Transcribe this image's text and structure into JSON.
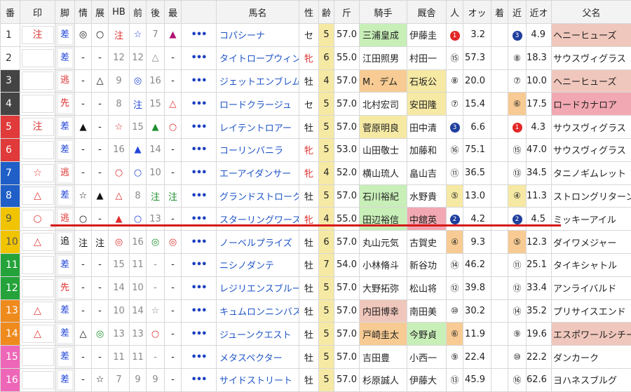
{
  "headers": [
    "番",
    "印",
    "脚",
    "情",
    "展",
    "HB",
    "前",
    "後",
    "最",
    "",
    "馬名",
    "性",
    "齢",
    "斤",
    "騎手",
    "厩舎",
    "人",
    "オッ",
    "着",
    "近",
    "近オ",
    "父名"
  ],
  "colors": {
    "num_bg": [
      "#ffffff",
      "#ffffff",
      "#444444",
      "#444444",
      "#e03a3a",
      "#e03a3a",
      "#1f5fc7",
      "#1f5fc7",
      "#f0c400",
      "#f0c400",
      "#25a33a",
      "#25a33a",
      "#ef8a1d",
      "#ef8a1d",
      "#ee66b8",
      "#ee66b8"
    ]
  },
  "rows": [
    {
      "num": "1",
      "mark": "注",
      "legs": "差",
      "j": "◎",
      "t": "○",
      "hb": "注",
      "f": "☆",
      "b": "7",
      "s": "▲",
      "more": "•••",
      "name": "コパシーナ",
      "sex": "セ",
      "age": "5",
      "kin": "57.0",
      "jockey": "三浦皇成",
      "trainer": "伊藤圭",
      "pop": "1",
      "odds": "3.2",
      "chaku": "",
      "kin_pop": "3",
      "kin_odds": "4.9",
      "sire": "ヘニーヒューズ"
    },
    {
      "num": "2",
      "mark": "",
      "legs": "差",
      "j": "-",
      "t": "-",
      "hb": "12",
      "f": "12",
      "b": "△",
      "s": "-",
      "more": "•••",
      "name": "タイトロープウィン",
      "sex": "牝",
      "age": "6",
      "kin": "55.0",
      "jockey": "江田照男",
      "trainer": "村田一",
      "pop": "⑮",
      "odds": "57.3",
      "chaku": "",
      "kin_pop": "⑧",
      "kin_odds": "18.3",
      "sire": "サウスヴィグラス"
    },
    {
      "num": "3",
      "mark": "",
      "legs": "逃",
      "j": "-",
      "t": "△",
      "hb": "9",
      "f": "◎",
      "b": "16",
      "s": "-",
      "more": "•••",
      "name": "ジェットエンブレム",
      "sex": "牡",
      "age": "4",
      "kin": "57.0",
      "jockey": "M．デム",
      "trainer": "石坂公",
      "pop": "⑧",
      "odds": "20.0",
      "chaku": "",
      "kin_pop": "⑦",
      "kin_odds": "10.0",
      "sire": "ヘニーヒューズ"
    },
    {
      "num": "4",
      "mark": "",
      "legs": "先",
      "j": "-",
      "t": "-",
      "hb": "8",
      "f": "注",
      "b": "15",
      "s": "△",
      "more": "•••",
      "name": "ロードクラージュ",
      "sex": "セ",
      "age": "5",
      "kin": "57.0",
      "jockey": "北村宏司",
      "trainer": "安田隆",
      "pop": "⑦",
      "odds": "15.4",
      "chaku": "",
      "kin_pop": "⑥",
      "kin_odds": "17.5",
      "sire": "ロードカナロア"
    },
    {
      "num": "5",
      "mark": "注",
      "legs": "差",
      "j": "▲",
      "t": "-",
      "hb": "☆",
      "f": "15",
      "b": "▲",
      "s": "○",
      "more": "•••",
      "name": "レイテントロアー",
      "sex": "牡",
      "age": "5",
      "kin": "57.0",
      "jockey": "菅原明良",
      "trainer": "田中清",
      "pop": "3",
      "odds": "6.6",
      "chaku": "",
      "kin_pop": "1",
      "kin_odds": "4.3",
      "sire": "サウスヴィグラス"
    },
    {
      "num": "6",
      "mark": "",
      "legs": "差",
      "j": "-",
      "t": "-",
      "hb": "16",
      "f": "▲",
      "b": "14",
      "s": "-",
      "more": "•••",
      "name": "コーリンバニラ",
      "sex": "牝",
      "age": "5",
      "kin": "53.0",
      "jockey": "山田敬士",
      "trainer": "加藤和",
      "pop": "⑯",
      "odds": "75.1",
      "chaku": "",
      "kin_pop": "⑮",
      "kin_odds": "47.0",
      "sire": "サウスヴィグラス"
    },
    {
      "num": "7",
      "mark": "☆",
      "legs": "逃",
      "j": "-",
      "t": "-",
      "hb": "○",
      "f": "○",
      "b": "10",
      "s": "-",
      "more": "•••",
      "name": "エーアイダンサー",
      "sex": "牝",
      "age": "4",
      "kin": "52.0",
      "jockey": "横山琉人",
      "trainer": "畠山吉",
      "pop": "⑪",
      "odds": "36.5",
      "chaku": "",
      "kin_pop": "⑬",
      "kin_odds": "34.5",
      "sire": "タニノギムレット"
    },
    {
      "num": "8",
      "mark": "△",
      "legs": "差",
      "j": "☆",
      "t": "▲",
      "hb": "△",
      "f": "8",
      "b": "注",
      "s": "注",
      "more": "•••",
      "name": "グランドストローク",
      "sex": "牡",
      "age": "5",
      "kin": "57.0",
      "jockey": "石川裕紀",
      "trainer": "水野貴",
      "pop": "⑤",
      "odds": "13.0",
      "chaku": "",
      "kin_pop": "④",
      "kin_odds": "11.3",
      "sire": "ストロングリターン"
    },
    {
      "num": "9",
      "mark": "○",
      "legs": "逃",
      "j": "○",
      "t": "-",
      "hb": "▲",
      "f": "○",
      "b": "13",
      "s": "-",
      "more": "•••",
      "name": "スターリングワース",
      "sex": "牝",
      "age": "4",
      "kin": "55.0",
      "jockey": "田辺裕信",
      "trainer": "中舘英",
      "pop": "2",
      "odds": "4.2",
      "chaku": "",
      "kin_pop": "2",
      "kin_odds": "4.5",
      "sire": "ミッキーアイル"
    },
    {
      "num": "10",
      "mark": "△",
      "legs": "追",
      "j": "注",
      "t": "注",
      "hb": "◎",
      "f": "16",
      "b": "◎",
      "s": "◎",
      "more": "•••",
      "name": "ノーベルプライズ",
      "sex": "牡",
      "age": "6",
      "kin": "57.0",
      "jockey": "丸山元気",
      "trainer": "古賀史",
      "pop": "④",
      "odds": "9.3",
      "chaku": "",
      "kin_pop": "⑤",
      "kin_odds": "12.3",
      "sire": "ダイワメジャー"
    },
    {
      "num": "11",
      "mark": "",
      "legs": "差",
      "j": "-",
      "t": "-",
      "hb": "15",
      "f": "11",
      "b": "-",
      "s": "-",
      "more": "•••",
      "name": "ニシノダンテ",
      "sex": "牡",
      "age": "7",
      "kin": "54.0",
      "jockey": "小林脩斗",
      "trainer": "新谷功",
      "pop": "⑭",
      "odds": "46.2",
      "chaku": "",
      "kin_pop": "⑪",
      "kin_odds": "25.1",
      "sire": "タイキシャトル"
    },
    {
      "num": "12",
      "mark": "",
      "legs": "先",
      "j": "-",
      "t": "-",
      "hb": "14",
      "f": "10",
      "b": "-",
      "s": "-",
      "more": "•••",
      "name": "レジリエンスブルー",
      "sex": "牡",
      "age": "5",
      "kin": "57.0",
      "jockey": "大野拓弥",
      "trainer": "松山将",
      "pop": "⑫",
      "odds": "39.8",
      "chaku": "",
      "kin_pop": "⑫",
      "kin_odds": "33.4",
      "sire": "アンライバルド"
    },
    {
      "num": "13",
      "mark": "△",
      "legs": "差",
      "j": "-",
      "t": "-",
      "hb": "10",
      "f": "14",
      "b": "☆",
      "s": "-",
      "more": "•••",
      "name": "キュムロンニンバス",
      "sex": "牡",
      "age": "5",
      "kin": "57.0",
      "jockey": "内田博幸",
      "trainer": "南田美",
      "pop": "⑩",
      "odds": "30.2",
      "chaku": "",
      "kin_pop": "⑭",
      "kin_odds": "35.2",
      "sire": "プリサイスエンド"
    },
    {
      "num": "14",
      "mark": "△",
      "legs": "差",
      "j": "△",
      "t": "◎",
      "hb": "13",
      "f": "13",
      "b": "○",
      "s": "-",
      "more": "•••",
      "name": "ジューンクエスト",
      "sex": "牡",
      "age": "5",
      "kin": "57.0",
      "jockey": "戸崎圭太",
      "trainer": "今野貞",
      "pop": "⑥",
      "odds": "11.9",
      "chaku": "",
      "kin_pop": "⑨",
      "kin_odds": "19.6",
      "sire": "エスポワールシチー"
    },
    {
      "num": "15",
      "mark": "",
      "legs": "差",
      "j": "-",
      "t": "-",
      "hb": "11",
      "f": "11",
      "b": "-",
      "s": "-",
      "more": "•••",
      "name": "メタスペクター",
      "sex": "牡",
      "age": "5",
      "kin": "57.0",
      "jockey": "吉田豊",
      "trainer": "小西一",
      "pop": "⑨",
      "odds": "22.4",
      "chaku": "",
      "kin_pop": "⑩",
      "kin_odds": "22.2",
      "sire": "ダンカーク"
    },
    {
      "num": "16",
      "mark": "",
      "legs": "差",
      "j": "-",
      "t": "☆",
      "hb": "7",
      "f": "9",
      "b": "9",
      "s": "-",
      "more": "•••",
      "name": "サイドストリート",
      "sex": "牡",
      "age": "5",
      "kin": "57.0",
      "jockey": "杉原誠人",
      "trainer": "伊藤大",
      "pop": "⑬",
      "odds": "45.9",
      "chaku": "",
      "kin_pop": "⑯",
      "kin_odds": "62.6",
      "sire": "ヨハネスブルグ"
    }
  ]
}
